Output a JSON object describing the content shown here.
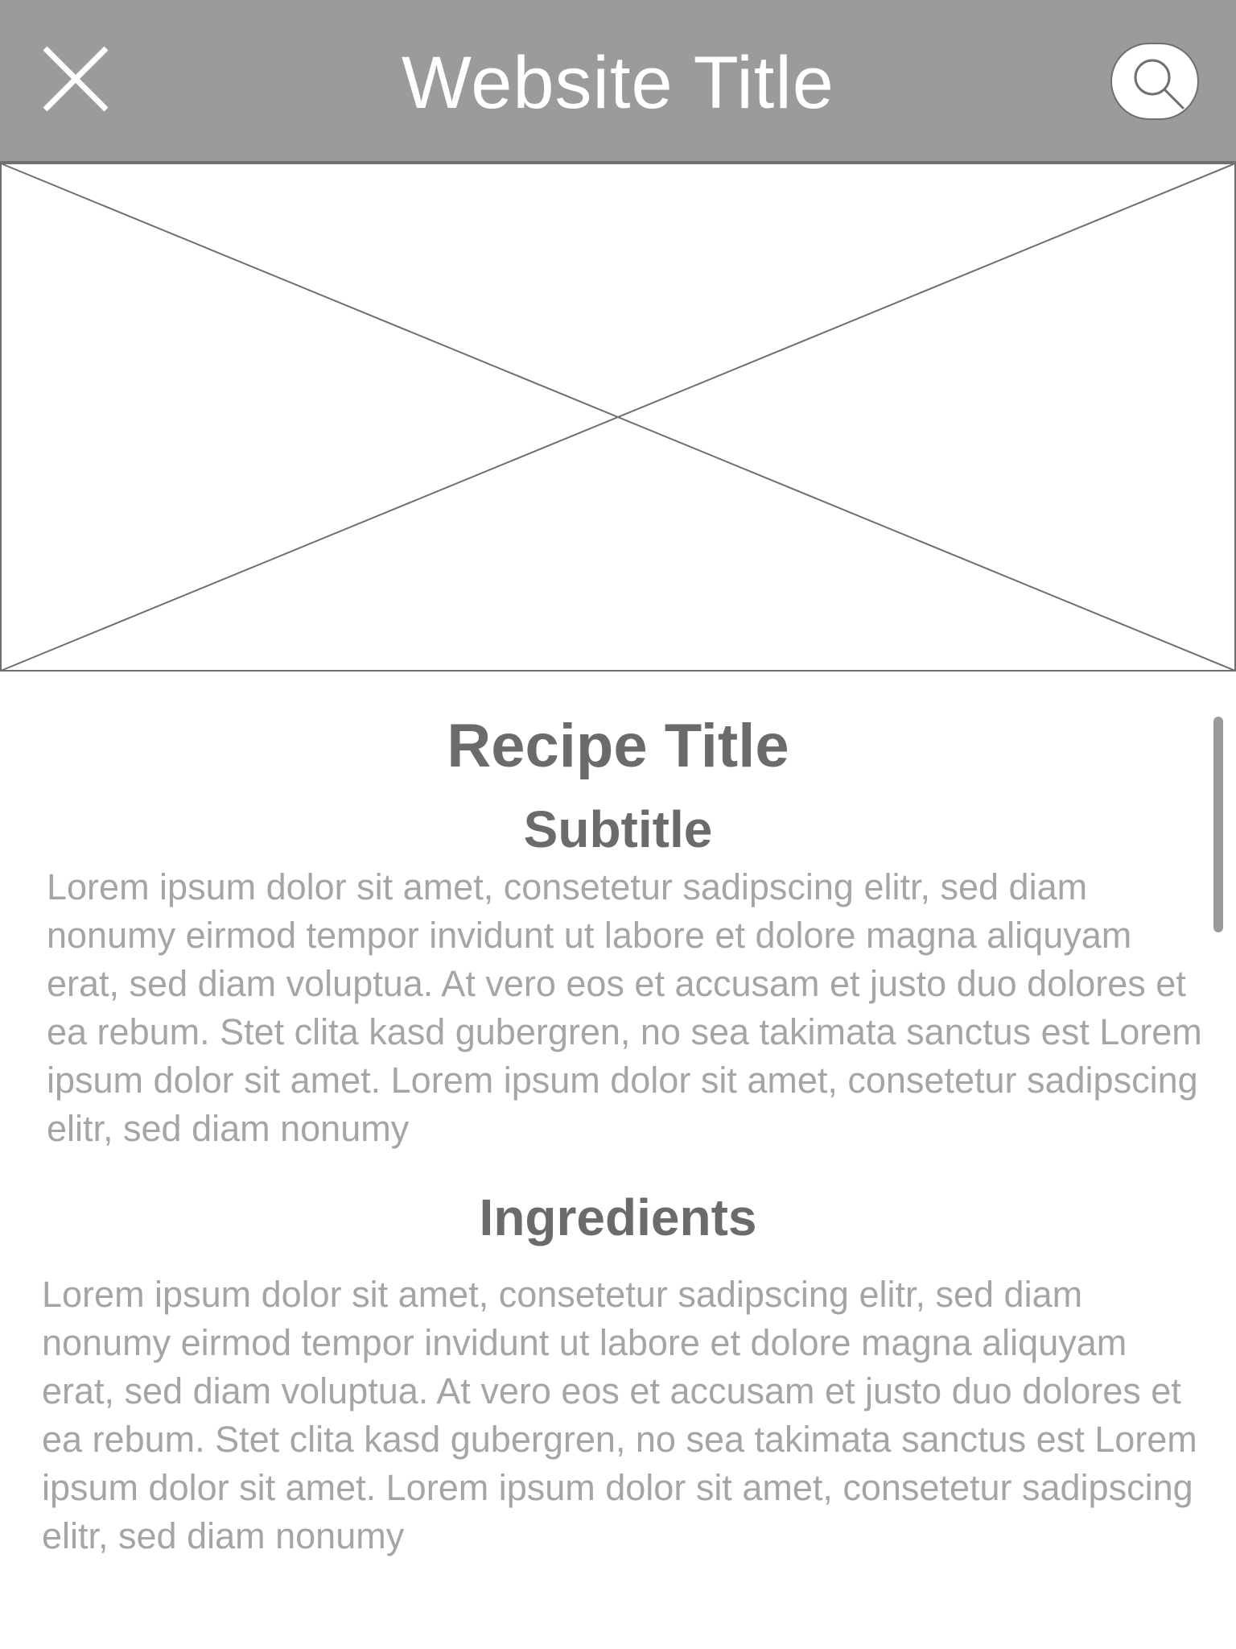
{
  "header": {
    "title": "Website Title",
    "close_icon": "close-icon",
    "search_icon": "search-icon",
    "background_color": "#9b9b9b"
  },
  "hero_image": {
    "kind": "image-placeholder"
  },
  "recipe": {
    "title": "Recipe Title",
    "subtitle": "Subtitle",
    "intro": "Lorem ipsum dolor sit amet, consetetur sadipscing elitr, sed diam nonumy eirmod tempor invidunt ut labore et dolore magna aliquyam erat, sed diam voluptua. At vero eos et accusam et justo duo dolores et ea rebum. Stet clita kasd gubergren, no sea takimata sanctus est Lorem ipsum dolor sit amet. Lorem ipsum dolor sit amet, consetetur sadipscing elitr, sed diam nonumy",
    "ingredients_heading": "Ingredients",
    "ingredients_text": "Lorem ipsum dolor sit amet, consetetur sadipscing elitr, sed diam nonumy eirmod tempor invidunt ut labore et dolore magna aliquyam erat, sed diam voluptua. At vero eos et accusam et justo duo dolores et ea rebum. Stet clita kasd gubergren, no sea takimata sanctus est Lorem ipsum dolor sit amet. Lorem ipsum dolor sit amet, consetetur sadipscing elitr, sed diam nonumy"
  }
}
